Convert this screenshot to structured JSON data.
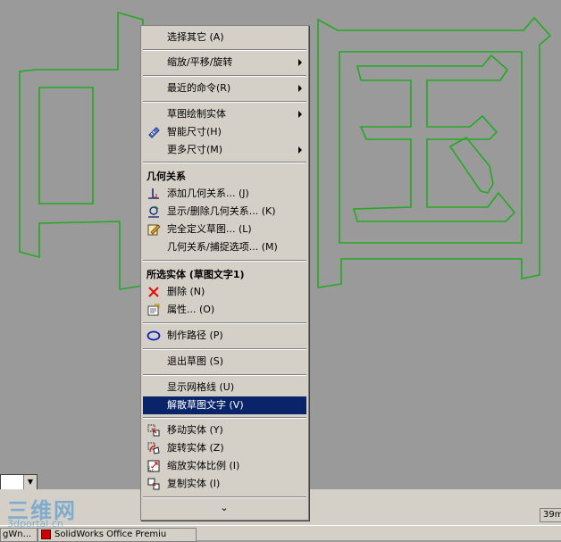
{
  "context_menu": {
    "items": [
      {
        "label": "选择其它 (A)",
        "icon": "",
        "submenu": false
      },
      {
        "label": "缩放/平移/旋转",
        "icon": "",
        "submenu": true
      },
      {
        "label": "最近的命令(R)",
        "icon": "",
        "submenu": true
      },
      {
        "label": "草图绘制实体",
        "icon": "",
        "submenu": true
      },
      {
        "label": "智能尺寸(H)",
        "icon": "smart-dimension-icon",
        "submenu": false
      },
      {
        "label": "更多尺寸(M)",
        "icon": "",
        "submenu": true
      },
      {
        "label": "添加几何关系... (J)",
        "icon": "add-relation-icon",
        "submenu": false
      },
      {
        "label": "显示/删除几何关系... (K)",
        "icon": "display-delete-relations-icon",
        "submenu": false
      },
      {
        "label": "完全定义草图... (L)",
        "icon": "fully-define-sketch-icon",
        "submenu": false
      },
      {
        "label": "几何关系/捕捉选项... (M)",
        "icon": "",
        "submenu": false
      },
      {
        "label": "删除 (N)",
        "icon": "delete-icon",
        "submenu": false
      },
      {
        "label": "属性... (O)",
        "icon": "properties-icon",
        "submenu": false
      },
      {
        "label": "制作路径 (P)",
        "icon": "make-path-icon",
        "submenu": false
      },
      {
        "label": "退出草图 (S)",
        "icon": "",
        "submenu": false
      },
      {
        "label": "显示网格线 (U)",
        "icon": "",
        "submenu": false
      },
      {
        "label": "解散草图文字 (V)",
        "icon": "",
        "submenu": false,
        "selected": true
      },
      {
        "label": "移动实体 (Y)",
        "icon": "move-entities-icon",
        "submenu": false
      },
      {
        "label": "旋转实体 (Z)",
        "icon": "rotate-entities-icon",
        "submenu": false
      },
      {
        "label": "缩放实体比例 (I)",
        "icon": "scale-entities-icon",
        "submenu": false
      },
      {
        "label": "复制实体 (I)",
        "icon": "copy-entities-icon",
        "submenu": false
      }
    ],
    "section_headers": {
      "relations": "几何关系",
      "selected_entity": "所选实体 (草图文字1)"
    },
    "more_glyph": "⌄"
  },
  "status": {
    "right_text": "39m"
  },
  "taskbar": {
    "task1": "gWn...",
    "task2": "SolidWorks Office Premiu"
  },
  "watermark": {
    "title": "三维网",
    "sub": "3dportal.cn"
  },
  "colors": {
    "background": "#9a9a9a",
    "sketch": "#22aa22",
    "menu": "#d4d0c8",
    "highlight": "#0a246a"
  }
}
